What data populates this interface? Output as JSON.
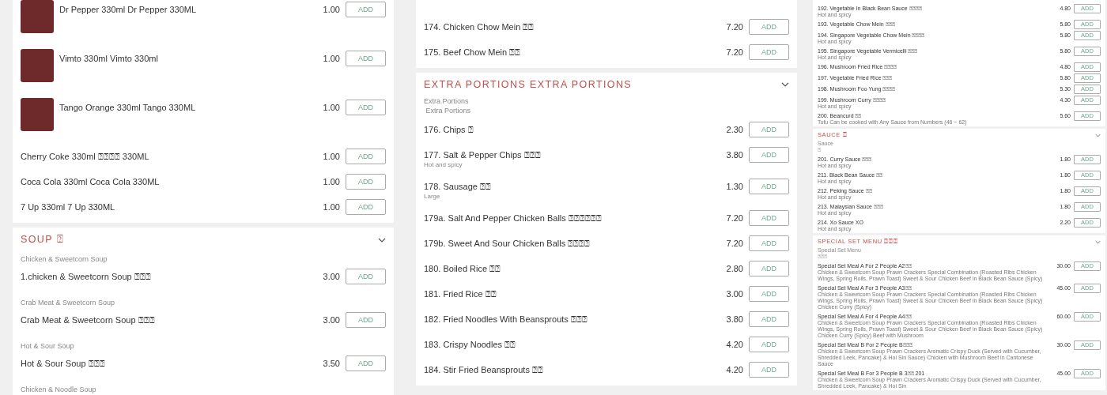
{
  "panels": [
    {
      "sections": [
        {
          "items": [
            {
              "kind": "product",
              "image": true,
              "name": "Dr Pepper 330ml Dr Pepper 330ML",
              "price": "1.00",
              "button": "ADD"
            },
            {
              "kind": "product",
              "image": true,
              "name": "Vimto 330ml Vimto 330ml",
              "price": "1.00",
              "button": "ADD"
            },
            {
              "kind": "product",
              "image": true,
              "name": "Tango Orange 330ml Tango 330ML",
              "price": "1.00",
              "button": "ADD"
            },
            {
              "kind": "product",
              "name": "Cherry Coke 330ml ⍰⍰⍰⍰ 330ML",
              "price": "1.00",
              "button": "ADD"
            },
            {
              "kind": "product",
              "name": "Coca Cola 330ml Coca Cola 330ML",
              "price": "1.00",
              "button": "ADD"
            },
            {
              "kind": "product",
              "name": "7 Up 330ml 7 Up 330ML",
              "price": "1.00",
              "button": "ADD"
            }
          ]
        },
        {
          "title": "SOUP ⍰",
          "items": [
            {
              "kind": "subheading",
              "text": "Chicken & Sweetcorn Soup"
            },
            {
              "kind": "product",
              "name": "1.chicken & Sweetcorn Soup ⍰⍰⍰",
              "price": "3.00",
              "button": "ADD"
            },
            {
              "kind": "subheading",
              "text": "Crab Meat & Sweetcorn Soup"
            },
            {
              "kind": "product",
              "name": "Crab Meat & Sweetcorn Soup ⍰⍰⍰",
              "price": "3.00",
              "button": "ADD"
            },
            {
              "kind": "subheading",
              "text": "Hot & Sour Soup"
            },
            {
              "kind": "product",
              "name": "Hot & Sour Soup ⍰⍰⍰",
              "price": "3.50",
              "button": "ADD"
            },
            {
              "kind": "subheading",
              "text": "Chicken & Noodle Soup"
            }
          ]
        }
      ]
    },
    {
      "sections": [
        {
          "items": [
            {
              "kind": "product",
              "name": "174. Chicken Chow Mein ⍰⍰",
              "price": "7.20",
              "button": "ADD"
            },
            {
              "kind": "product",
              "name": "175. Beef Chow Mein ⍰⍰",
              "price": "7.20",
              "button": "ADD"
            }
          ]
        },
        {
          "title": "EXTRA PORTIONS EXTRA PORTIONS",
          "intro": [
            "Extra Portions",
            " Extra Portions"
          ],
          "items": [
            {
              "kind": "product",
              "name": "176. Chips ⍰",
              "price": "2.30",
              "button": "ADD"
            },
            {
              "kind": "product",
              "name": "177. Salt & Pepper Chips ⍰⍰⍰",
              "note": "Hot and spicy",
              "price": "3.80",
              "button": "ADD"
            },
            {
              "kind": "product",
              "name": "178. Sausage ⍰⍰",
              "note": "Large",
              "price": "1.30",
              "button": "ADD"
            },
            {
              "kind": "product",
              "name": "179a. Salt And Pepper Chicken Balls ⍰⍰⍰⍰⍰⍰",
              "price": "7.20",
              "button": "ADD"
            },
            {
              "kind": "product",
              "name": "179b. Sweet And Sour Chicken Balls ⍰⍰⍰⍰",
              "price": "7.20",
              "button": "ADD"
            },
            {
              "kind": "product",
              "name": "180. Boiled Rice ⍰⍰",
              "price": "2.80",
              "button": "ADD"
            },
            {
              "kind": "product",
              "name": "181. Fried Rice ⍰⍰",
              "price": "3.00",
              "button": "ADD"
            },
            {
              "kind": "product",
              "name": "182. Fried Noodles With Beansprouts ⍰⍰⍰",
              "price": "3.80",
              "button": "ADD"
            },
            {
              "kind": "product",
              "name": "183. Crispy Noodles ⍰⍰",
              "price": "4.20",
              "button": "ADD"
            },
            {
              "kind": "product",
              "name": "184. Stir Fried Beansprouts ⍰⍰",
              "price": "4.20",
              "button": "ADD"
            }
          ]
        }
      ]
    },
    {
      "sections": [
        {
          "items": [
            {
              "kind": "product",
              "name": "192. Vegetable In Black Bean Sauce ⍰⍰⍰⍰",
              "note": "Hot and spicy",
              "price": "4.80",
              "button": "ADD"
            },
            {
              "kind": "product",
              "name": "193. Vegetable Chow Mein ⍰⍰⍰",
              "price": "5.80",
              "button": "ADD"
            },
            {
              "kind": "product",
              "name": "194. Singapore Vegetable Chow Mein ⍰⍰⍰⍰",
              "note": "Hot and spicy",
              "price": "5.80",
              "button": "ADD"
            },
            {
              "kind": "product",
              "name": "195. Singapore Vegetable Vermicelli ⍰⍰⍰",
              "note": "Hot and spicy",
              "price": "5.80",
              "button": "ADD"
            },
            {
              "kind": "product",
              "name": "196. Mushroom Fried Rice ⍰⍰⍰⍰",
              "price": "4.80",
              "button": "ADD"
            },
            {
              "kind": "product",
              "name": "197. Vegetable Fried Rice ⍰⍰⍰",
              "price": "5.80",
              "button": "ADD"
            },
            {
              "kind": "product",
              "name": "198. Mushroom Foo Yung ⍰⍰⍰⍰",
              "price": "5.30",
              "button": "ADD"
            },
            {
              "kind": "product",
              "name": "199. Mushroom Curry ⍰⍰⍰⍰",
              "note": "Hot and spicy",
              "price": "4.30",
              "button": "ADD"
            },
            {
              "kind": "product",
              "name": "200. Beancurd ⍰⍰",
              "note": "Tofu Can be cooked with Any Sauce from Numbers (46 ~ 62)",
              "price": "5.60",
              "button": "ADD"
            }
          ]
        },
        {
          "title": "SAUCE ⍰",
          "intro": [
            "Sauce",
            "⍰"
          ],
          "items": [
            {
              "kind": "product",
              "name": "201. Curry Sauce ⍰⍰⍰",
              "note": "Hot and spicy",
              "price": "1.80",
              "button": "ADD"
            },
            {
              "kind": "product",
              "name": "211. Black Bean Sauce ⍰⍰",
              "note": "Hot and spicy",
              "price": "1.80",
              "button": "ADD"
            },
            {
              "kind": "product",
              "name": "212. Peking Sauce ⍰⍰",
              "note": "Hot and spicy",
              "price": "1.80",
              "button": "ADD"
            },
            {
              "kind": "product",
              "name": "213. Malaysian Sauce ⍰⍰⍰",
              "note": "Hot and spicy",
              "price": "1.80",
              "button": "ADD"
            },
            {
              "kind": "product",
              "name": "214. Xo Sauce XO",
              "note": "Hot and spicy",
              "price": "2.20",
              "button": "ADD"
            }
          ]
        },
        {
          "title": "SPECIAL SET MENU ⍰⍰⍰",
          "intro": [
            "Special Set Menu",
            "⍰⍰⍰"
          ],
          "items": [
            {
              "kind": "product",
              "name": "Special Set Meal A For 2 People A2⍰⍰",
              "note": "Chicken & Sweetcorn Soup Prawn Crackers Special Combination (Roasted Ribs Chicken Wings, Spring Rolls, Prawn Toast) Sweet & Sour Chicken Beef in Black Bean Sauce (Spicy)",
              "price": "30.00",
              "button": "ADD"
            },
            {
              "kind": "product",
              "name": "Special Set Meal A For 3 People A3⍰⍰",
              "note": "Chicken & Sweetcorn Soup Prawn Crackers Special Combination (Roasted Ribs Chicken Wings, Spring Rolls, Prawn Toast) Sweet & Sour Chicken Beef in Black Bean Sauce (Spicy) Chicken Curry (Spicy)",
              "price": "45.00",
              "button": "ADD"
            },
            {
              "kind": "product",
              "name": "Special Set Meal A For 4 People A4⍰⍰",
              "note": "Chicken & Sweetcorn Soup Prawn Crackers Special Combination (Roasted Ribs Chicken Wings, Spring Rolls, Prawn Toast) Sweet & Sour Chicken Beef in Black Bean Sauce (Spicy) Chicken Curry (Spicy) Beef with Mushroom",
              "price": "60.00",
              "button": "ADD"
            },
            {
              "kind": "product",
              "name": "Special Set Meal B For 2 People B⍰⍰⍰",
              "note": "Chicken & Sweetcorn Soup Prawn Crackers Aromatic Crispy Duck (Served with Cucumber, Shredded Leek, Pancake) & Hoi Sin Sauce) Chicken with Mushroom Beef in Cantonese Sauce",
              "price": "30.00",
              "button": "ADD"
            },
            {
              "kind": "product",
              "name": "Special Set Meal B For 3 People B 3⍰⍰ 201",
              "note": "Chicken & Sweetcorn Soup Prawn Crackers Aromatic Crispy Duck (Served with Cucumber, Shredded Leek, Pancake) & Hoi Sin",
              "price": "45.00",
              "button": "ADD"
            }
          ]
        }
      ]
    }
  ]
}
